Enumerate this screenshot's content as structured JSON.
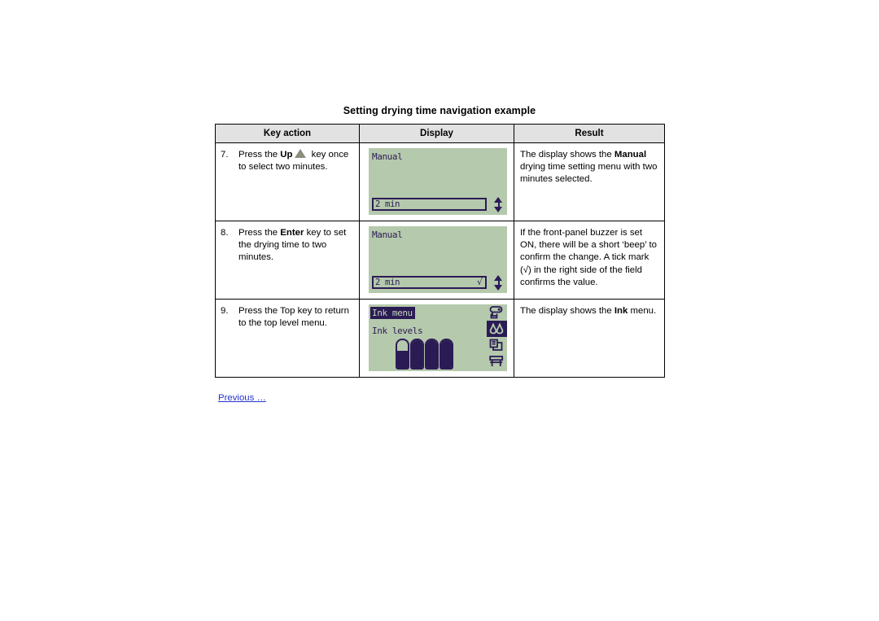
{
  "document": {
    "title": "Setting drying time navigation example",
    "footer_link": "Previous …"
  },
  "table": {
    "headers": {
      "key_action": "Key action",
      "display": "Display",
      "result": "Result"
    },
    "rows": [
      {
        "number": "7.",
        "key_action_pre": "Press the ",
        "key_action_bold": "Up",
        "key_action_icon": "up-triangle-icon",
        "key_action_post": " key once to select two minutes.",
        "display": {
          "type": "value-field-screen",
          "title": "Manual",
          "title_inverted": false,
          "field_value": "2 min",
          "field_tick": "",
          "has_tick": false,
          "has_scroll_arrows": true
        },
        "result_parts": [
          {
            "text": "The display shows the ",
            "bold": false
          },
          {
            "text": "Manual",
            "bold": true
          },
          {
            "text": " drying time setting menu with two minutes selected.",
            "bold": false
          }
        ]
      },
      {
        "number": "8.",
        "key_action_pre": "Press the ",
        "key_action_bold": "Enter",
        "key_action_icon": "",
        "key_action_post": " key to set the drying time to two minutes.",
        "display": {
          "type": "value-field-screen",
          "title": "Manual",
          "title_inverted": false,
          "field_value": "2 min",
          "field_tick": "√",
          "has_tick": true,
          "has_scroll_arrows": true
        },
        "result_parts": [
          {
            "text": "If the front-panel buzzer is set ON, there will be a short ‘beep’ to confirm the change. A tick mark (√) in the right side of the field confirms the value.",
            "bold": false
          }
        ]
      },
      {
        "number": "9.",
        "key_action_pre": "Press the Top key to return to the top level menu.",
        "key_action_bold": "",
        "key_action_icon": "",
        "key_action_post": "",
        "display": {
          "type": "ink-menu-screen",
          "title": "Ink menu",
          "title_inverted": true,
          "subtitle": "Ink levels",
          "ink_levels": [
            62,
            100,
            100,
            100
          ],
          "menu_icons": [
            {
              "name": "paper-roll-icon",
              "selected": false
            },
            {
              "name": "ink-drop-icon",
              "selected": true
            },
            {
              "name": "pages-layout-icon",
              "selected": false
            },
            {
              "name": "printer-icon",
              "selected": false
            }
          ]
        },
        "result_parts": [
          {
            "text": "The display shows the ",
            "bold": false
          },
          {
            "text": "Ink",
            "bold": true
          },
          {
            "text": " menu.",
            "bold": false
          }
        ]
      }
    ]
  },
  "colors": {
    "lcd_background": "#b5c9ac",
    "lcd_foreground": "#2b1b55",
    "header_background": "#e2e2e2",
    "link": "#2633cc",
    "up_key_icon": "#8b8e7c"
  }
}
